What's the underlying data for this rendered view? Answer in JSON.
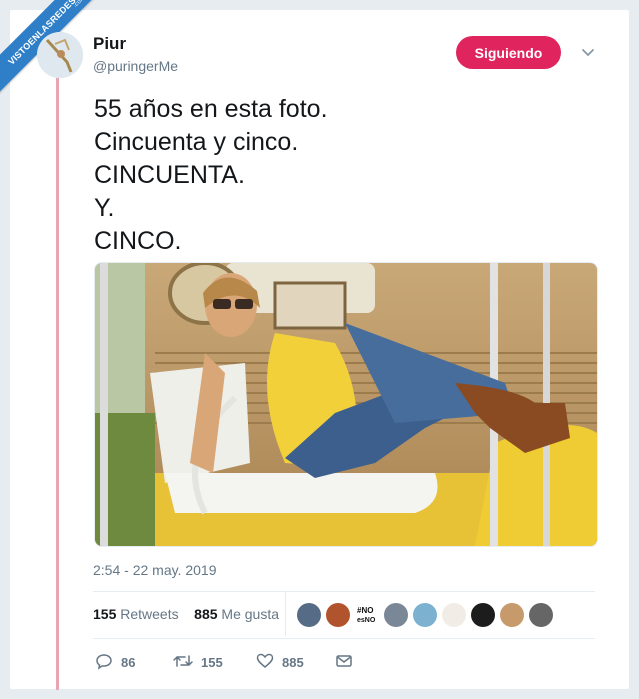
{
  "watermark": {
    "text": "VISTOENLASREDES",
    "sub": ".com"
  },
  "author": {
    "name": "Piur",
    "handle": "@puringerMe"
  },
  "follow_button": {
    "label": "Siguiendo",
    "color": "#e0245e"
  },
  "tweet": {
    "lines": [
      "55 años en esta foto.",
      "Cincuenta y cinco.",
      "CINCUENTA.",
      "Y.",
      "CINCO."
    ],
    "timestamp": "2:54 - 22 may. 2019"
  },
  "stats": {
    "retweets_count": "155",
    "retweets_label": "Retweets",
    "likes_count": "885",
    "likes_label": "Me gusta",
    "liker_avatars": [
      "avatar",
      "avatar",
      "avatar-no-es-no",
      "avatar",
      "avatar",
      "avatar",
      "avatar",
      "avatar",
      "avatar"
    ]
  },
  "actions": {
    "replies": "86",
    "retweets": "155",
    "likes": "885"
  },
  "colors": {
    "accent": "#e0245e",
    "thread": "#e8a5b4",
    "muted": "#657786",
    "background": "#e6ecf0"
  },
  "icons": [
    "chevron-down-icon",
    "reply-icon",
    "retweet-icon",
    "heart-icon",
    "message-icon"
  ]
}
